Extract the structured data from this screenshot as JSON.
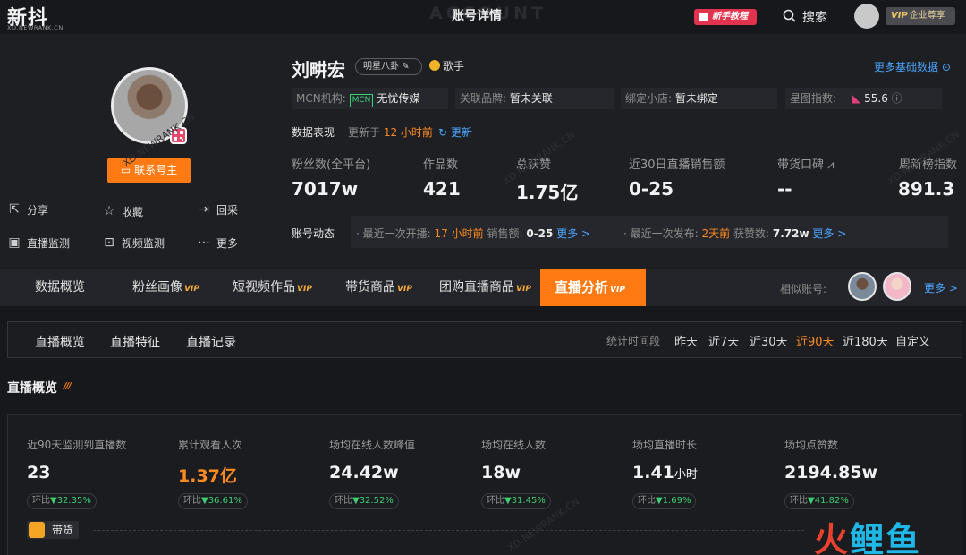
{
  "topbar": {
    "logo": "新抖",
    "logo_sub": "XD.NEWRANK.CN",
    "ghost_text": "ACCOUNT",
    "page_title": "账号详情",
    "guide_button": "新手教程",
    "search_label": "搜索",
    "vip_prefix": "VIP",
    "vip_label": "企业尊享"
  },
  "profile": {
    "name": "刘畊宏",
    "tag": "明星八卦",
    "role": "歌手",
    "more_basic": "更多基础数据",
    "contact_button": "联系号主",
    "actions": {
      "share": "分享",
      "favorite": "收藏",
      "backtrack": "回采",
      "live_monitor": "直播监测",
      "video_monitor": "视频监测",
      "more": "更多"
    },
    "info": {
      "mcn_label": "MCN机构:",
      "mcn_badge": "MCN",
      "mcn_value": "无忧传媒",
      "brand_label": "关联品牌:",
      "brand_value": "暂未关联",
      "shop_label": "绑定小店:",
      "shop_value": "暂未绑定",
      "star_label": "星图指数:",
      "star_value": "55.6"
    },
    "performance": {
      "title": "数据表现",
      "updated_prefix": "更新于",
      "updated_value": "12 小时前",
      "refresh": "更新"
    },
    "stats": [
      {
        "label": "粉丝数(全平台)",
        "value": "7017w"
      },
      {
        "label": "作品数",
        "value": "421"
      },
      {
        "label": "总获赞",
        "value": "1.75亿"
      },
      {
        "label": "近30日直播销售额",
        "value": "0-25"
      },
      {
        "label": "带货口碑",
        "value": "--"
      },
      {
        "label": "周新榜指数",
        "value": "891.3"
      }
    ],
    "dynamics": {
      "title": "账号动态",
      "live_prefix": "· 最近一次开播:",
      "live_time": "17 小时前",
      "sales_label": "销售额:",
      "sales_value": "0-25",
      "more1": "更多 >",
      "post_prefix": "· 最近一次发布:",
      "post_time": "2天前",
      "likes_label": "获赞数:",
      "likes_value": "7.72w",
      "more2": "更多 >"
    }
  },
  "tabs": {
    "items": [
      "数据概览",
      "粉丝画像",
      "短视频作品",
      "带货商品",
      "团购直播商品"
    ],
    "vip_flags": [
      false,
      true,
      true,
      true,
      true
    ],
    "active": "直播分析",
    "vip_text": "VIP",
    "similar_label": "相似账号:",
    "similar_more": "更多 >"
  },
  "subtabs": {
    "items": [
      "直播概览",
      "直播特征",
      "直播记录"
    ],
    "period_label": "统计时间段",
    "periods": [
      "昨天",
      "近7天",
      "近30天",
      "近90天",
      "近180天",
      "自定义"
    ],
    "active_period": "近90天"
  },
  "overview": {
    "title": "直播概览",
    "kpis": [
      {
        "label": "近90天监测到直播数",
        "value": "23",
        "unit": "",
        "change_label": "环比",
        "change": "▼32.35%"
      },
      {
        "label": "累计观看人次",
        "value": "1.37亿",
        "unit": "",
        "change_label": "环比",
        "change": "▼36.61%"
      },
      {
        "label": "场均在线人数峰值",
        "value": "24.42w",
        "unit": "",
        "change_label": "环比",
        "change": "▼32.52%"
      },
      {
        "label": "场均在线人数",
        "value": "18w",
        "unit": "",
        "change_label": "环比",
        "change": "▼31.45%"
      },
      {
        "label": "场均直播时长",
        "value": "1.41",
        "unit": "小时",
        "change_label": "环比",
        "change": "▼1.69%"
      },
      {
        "label": "场均点赞数",
        "value": "2194.85w",
        "unit": "",
        "change_label": "环比",
        "change": "▼41.82%"
      }
    ],
    "goods_label": "带货"
  },
  "brand": {
    "part1": "火",
    "part2": "鲤鱼"
  },
  "colors": {
    "accent": "#ff7a12",
    "link": "#4aa6ff",
    "down": "#3ecf72",
    "background": "#17181c"
  }
}
